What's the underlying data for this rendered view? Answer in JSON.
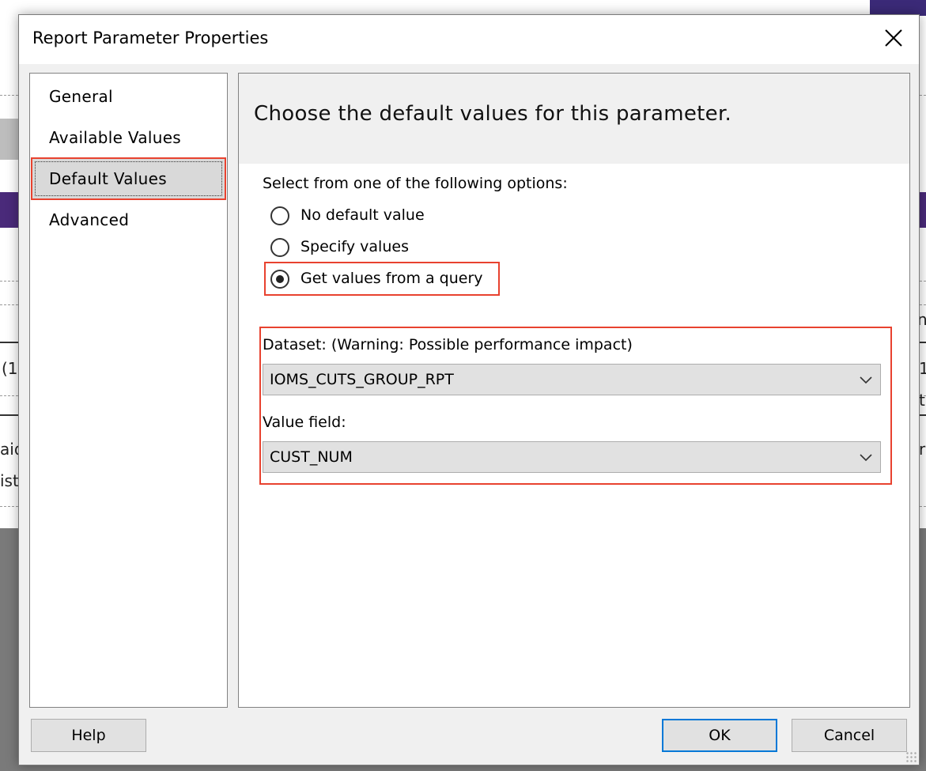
{
  "dialog": {
    "title": "Report Parameter Properties",
    "close_glyph": "✕"
  },
  "nav": {
    "items": [
      {
        "label": "General",
        "selected": false
      },
      {
        "label": "Available Values",
        "selected": false
      },
      {
        "label": "Default Values",
        "selected": true
      },
      {
        "label": "Advanced",
        "selected": false
      }
    ]
  },
  "content": {
    "heading": "Choose the default values for this parameter.",
    "prompt": "Select from one of the following options:",
    "options": [
      {
        "label": "No default value",
        "checked": false
      },
      {
        "label": "Specify values",
        "checked": false
      },
      {
        "label": "Get values from a query",
        "checked": true
      }
    ],
    "dataset": {
      "label": "Dataset: (Warning: Possible performance impact)",
      "value": "IOMS_CUTS_GROUP_RPT"
    },
    "value_field": {
      "label": "Value field:",
      "value": "CUST_NUM"
    }
  },
  "buttons": {
    "help": "Help",
    "ok": "OK",
    "cancel": "Cancel"
  },
  "background": {
    "fragments": [
      "(1",
      "aid",
      "ist",
      "1",
      "t",
      "r",
      "nl"
    ]
  },
  "colors": {
    "highlight": "#e8422f",
    "default_button_border": "#0078d7"
  }
}
